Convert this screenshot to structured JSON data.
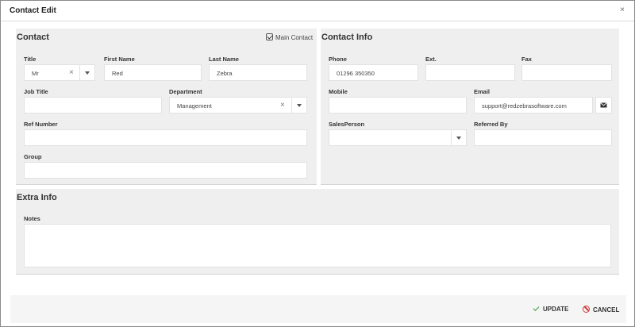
{
  "modal": {
    "title": "Contact Edit",
    "close_glyph": "×"
  },
  "contact": {
    "heading": "Contact",
    "main_contact_label": "Main Contact",
    "main_contact_checked": true,
    "title": {
      "label": "Title",
      "value": "Mr",
      "clear_glyph": "×"
    },
    "first_name": {
      "label": "First Name",
      "value": "Red"
    },
    "last_name": {
      "label": "Last Name",
      "value": "Zebra"
    },
    "job_title": {
      "label": "Job Title",
      "value": ""
    },
    "department": {
      "label": "Department",
      "value": "Management",
      "clear_glyph": "×"
    },
    "ref_number": {
      "label": "Ref Number",
      "value": ""
    },
    "group": {
      "label": "Group",
      "value": ""
    }
  },
  "contact_info": {
    "heading": "Contact Info",
    "phone": {
      "label": "Phone",
      "value": "01296 350350"
    },
    "ext": {
      "label": "Ext.",
      "value": ""
    },
    "fax": {
      "label": "Fax",
      "value": ""
    },
    "mobile": {
      "label": "Mobile",
      "value": ""
    },
    "email": {
      "label": "Email",
      "value": "support@redzebrasoftware.com"
    },
    "salesperson": {
      "label": "SalesPerson",
      "value": ""
    },
    "referred_by": {
      "label": "Referred By",
      "value": ""
    }
  },
  "extra_info": {
    "heading": "Extra Info",
    "notes": {
      "label": "Notes",
      "value": ""
    }
  },
  "footer": {
    "update_label": "UPDATE",
    "cancel_label": "CANCEL"
  },
  "colors": {
    "update_icon": "#3a9a3a",
    "cancel_icon": "#d23a3a",
    "panel_bg": "#efefef"
  },
  "icons": {
    "mail": "envelope-icon",
    "update": "check-icon",
    "cancel": "cancel-icon",
    "close": "close-icon"
  }
}
